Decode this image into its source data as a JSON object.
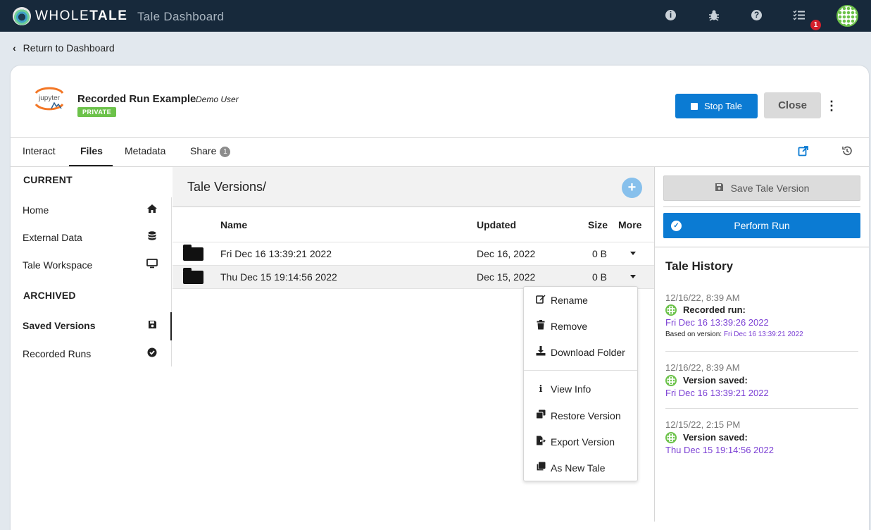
{
  "navbar": {
    "brand_a": "WHOLE",
    "brand_b": "TALE",
    "title": "Tale Dashboard",
    "notifications_count": "1",
    "icons": [
      "info-icon",
      "bug-icon",
      "help-icon",
      "tasks-icon",
      "user-avatar"
    ]
  },
  "back_link": "Return to Dashboard",
  "tale": {
    "title": "Recorded Run Example",
    "author": "Demo User",
    "visibility": "PRIVATE",
    "logo_text": "jupyter",
    "stop_label": "Stop Tale",
    "close_label": "Close"
  },
  "tabs": [
    {
      "label": "Interact"
    },
    {
      "label": "Files",
      "active": true
    },
    {
      "label": "Metadata"
    },
    {
      "label": "Share",
      "count": "1"
    }
  ],
  "leftnav": {
    "current_heading": "CURRENT",
    "current_items": [
      {
        "label": "Home",
        "icon": "home-icon"
      },
      {
        "label": "External Data",
        "icon": "database-icon"
      },
      {
        "label": "Tale Workspace",
        "icon": "monitor-icon"
      }
    ],
    "archived_heading": "ARCHIVED",
    "archived_items": [
      {
        "label": "Saved Versions",
        "icon": "save-icon",
        "active": true
      },
      {
        "label": "Recorded Runs",
        "icon": "check-circle-icon"
      }
    ]
  },
  "files": {
    "path": "Tale Versions/",
    "columns": {
      "name": "Name",
      "updated": "Updated",
      "size": "Size",
      "more": "More"
    },
    "rows": [
      {
        "name": "Fri Dec 16 13:39:21 2022",
        "updated": "Dec 16, 2022",
        "size": "0 B"
      },
      {
        "name": "Thu Dec 15 19:14:56 2022",
        "updated": "Dec 15, 2022",
        "size": "0 B"
      }
    ]
  },
  "menu": {
    "items": [
      {
        "label": "Rename",
        "icon": "edit-icon"
      },
      {
        "label": "Remove",
        "icon": "trash-icon"
      },
      {
        "label": "Download Folder",
        "icon": "download-icon"
      },
      {
        "label": "View Info",
        "icon": "info-icon"
      },
      {
        "label": "Restore Version",
        "icon": "restore-icon"
      },
      {
        "label": "Export Version",
        "icon": "export-icon"
      },
      {
        "label": "As New Tale",
        "icon": "copy-icon"
      }
    ]
  },
  "right": {
    "save_version": "Save Tale Version",
    "perform_run": "Perform Run",
    "history_title": "Tale History",
    "history": [
      {
        "date": "12/16/22, 8:39 AM",
        "label": "Recorded run:",
        "link": "Fri Dec 16 13:39:26 2022",
        "based_prefix": "Based on version:",
        "based_link": "Fri Dec 16 13:39:21 2022"
      },
      {
        "date": "12/16/22, 8:39 AM",
        "label": "Version saved:",
        "link": "Fri Dec 16 13:39:21 2022"
      },
      {
        "date": "12/15/22, 2:15 PM",
        "label": "Version saved:",
        "link": "Thu Dec 15 19:14:56 2022"
      }
    ]
  },
  "colors": {
    "navbar": "#17293b",
    "primary": "#0b7bd3",
    "private": "#6cc24a",
    "link": "#7b3fd4",
    "badge": "#d3202c"
  }
}
